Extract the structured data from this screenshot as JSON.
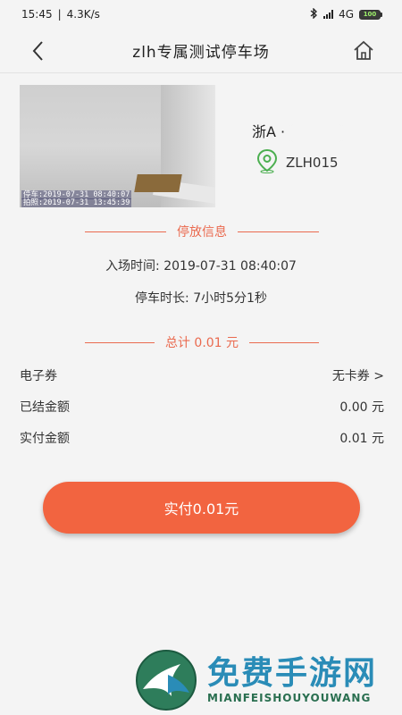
{
  "status_bar": {
    "time": "15:45",
    "speed": "4.3K/s",
    "network": "4G",
    "battery": "100"
  },
  "nav": {
    "title": "zlh专属测试停车场"
  },
  "vehicle": {
    "plate_prefix": "浙A ·",
    "lot_code": "ZLH015",
    "photo_stamp_entry": "停车:2019-07-31 08:40:07",
    "photo_stamp_capture": "拍照:2019-07-31 13:45:39"
  },
  "parking_info": {
    "section_title": "停放信息",
    "entry_label": "入场时间:",
    "entry_time": "2019-07-31 08:40:07",
    "duration_label": "停车时长:",
    "duration": "7小时5分1秒"
  },
  "total": {
    "label": "总计 0.01 元"
  },
  "rows": [
    {
      "label": "电子券",
      "value": "无卡券 >"
    },
    {
      "label": "已结金额",
      "value": "0.00 元"
    },
    {
      "label": "实付金额",
      "value": "0.01 元"
    }
  ],
  "pay_button_label": "实付0.01元",
  "watermark": {
    "title": "免费手游网",
    "subtitle": "MIANFEISHOUYOUWANG"
  },
  "colors": {
    "accent": "#f26440",
    "divider": "#ea6a4f",
    "pin": "#4caf50"
  },
  "icons": [
    "back-arrow-icon",
    "home-icon",
    "location-pin-icon",
    "signal-icon",
    "bluetooth-icon",
    "battery-icon"
  ]
}
